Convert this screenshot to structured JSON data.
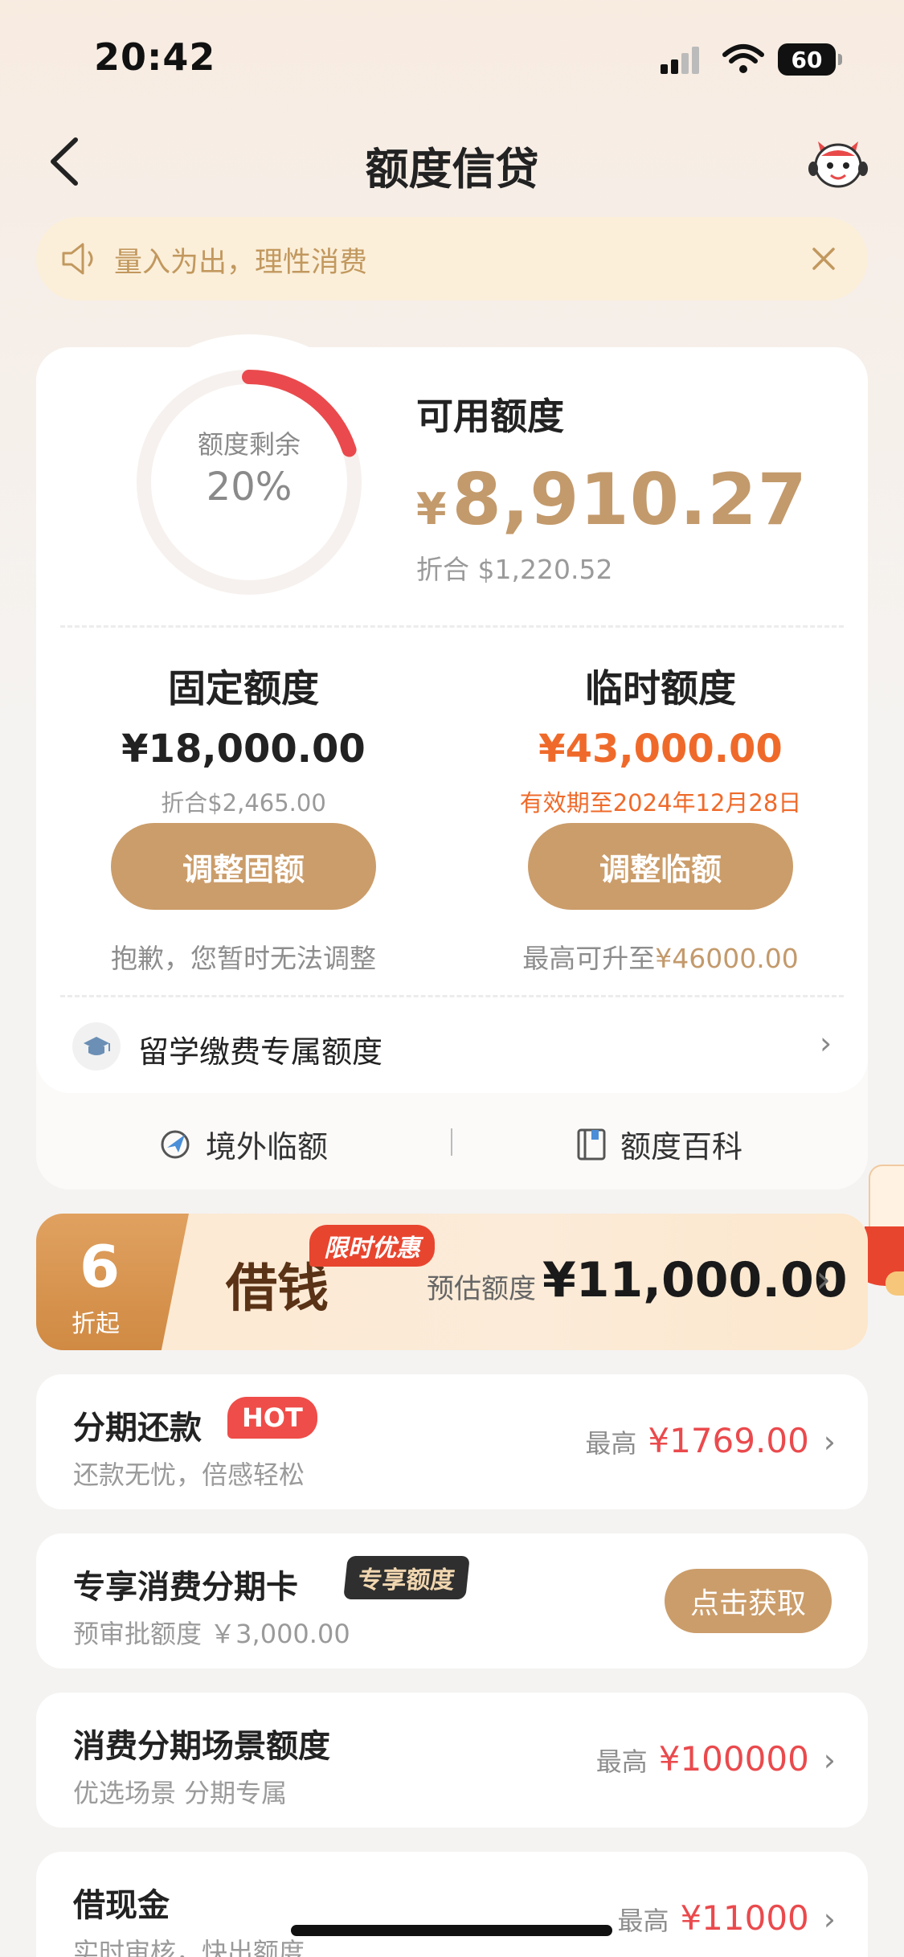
{
  "status_bar": {
    "time": "20:42",
    "battery": "60"
  },
  "nav": {
    "title": "额度信贷"
  },
  "notice": {
    "text": "量入为出，理性消费"
  },
  "quota": {
    "ring_caption": "额度剩余",
    "ring_value": "20%",
    "ring_fraction": 0.2,
    "available_label": "可用额度",
    "available_currency": "¥",
    "available_amount": "8,910.27",
    "available_converted": "折合  $1,220.52"
  },
  "fixed": {
    "title": "固定额度",
    "amount": "¥18,000.00",
    "converted": "折合$2,465.00",
    "button": "调整固额",
    "note": "抱歉，您暂时无法调整"
  },
  "temp": {
    "title": "临时额度",
    "amount": "¥43,000.00",
    "validity": "有效期至2024年12月28日",
    "button": "调整临额",
    "note_prefix": "最高可升至",
    "note_value": "¥46000.00"
  },
  "study": {
    "label": "留学缴费专属额度"
  },
  "links": {
    "overseas": "境外临额",
    "wiki": "额度百科"
  },
  "loan": {
    "discount_num": "6",
    "discount_sub": "折起",
    "tag": "限时优惠",
    "title": "借钱",
    "estimate_label": "预估额度",
    "estimate_amount": "¥11,000.00"
  },
  "installment": {
    "title": "分期还款",
    "badge": "HOT",
    "subtitle": "还款无忧，倍感轻松",
    "max_label": "最高",
    "max_value": "¥1769.00"
  },
  "card_installment": {
    "title": "专享消费分期卡",
    "badge": "专享额度",
    "subtitle": "预审批额度 ￥3,000.00",
    "button": "点击获取"
  },
  "scene": {
    "title": "消费分期场景额度",
    "subtitle": "优选场景 分期专属",
    "max_label": "最高",
    "max_value": "¥100000"
  },
  "cash": {
    "title": "借现金",
    "subtitle": "实时审核，快出额度",
    "max_label": "最高",
    "max_value": "¥11000"
  },
  "colors": {
    "accent_gold": "#c39a6c",
    "button_gold": "#cb9d6a",
    "warning_orange": "#ef6a2a",
    "price_red": "#ea4a4d"
  }
}
